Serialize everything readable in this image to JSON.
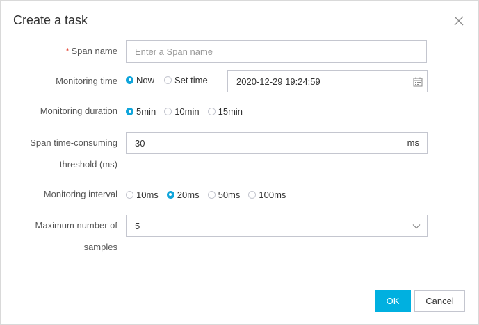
{
  "dialog": {
    "title": "Create a task",
    "close_icon": "close-icon"
  },
  "span_name": {
    "required_mark": "*",
    "label": "Span name",
    "placeholder": "Enter a Span name",
    "value": ""
  },
  "monitoring_time": {
    "label": "Monitoring time",
    "options": [
      {
        "label": "Now",
        "selected": true
      },
      {
        "label": "Set time",
        "selected": false
      }
    ],
    "datetime_value": "2020-12-29 19:24:59",
    "icon": "calendar-icon"
  },
  "monitoring_duration": {
    "label": "Monitoring duration",
    "options": [
      {
        "label": "5min",
        "selected": true
      },
      {
        "label": "10min",
        "selected": false
      },
      {
        "label": "15min",
        "selected": false
      }
    ]
  },
  "threshold": {
    "label_line1": "Span time-consuming",
    "label_line2": "threshold (ms)",
    "value": "30",
    "suffix": "ms"
  },
  "monitoring_interval": {
    "label": "Monitoring interval",
    "options": [
      {
        "label": "10ms",
        "selected": false
      },
      {
        "label": "20ms",
        "selected": true
      },
      {
        "label": "50ms",
        "selected": false
      },
      {
        "label": "100ms",
        "selected": false
      }
    ]
  },
  "max_samples": {
    "label_line1": "Maximum number of",
    "label_line2": "samples",
    "value": "5",
    "icon": "chevron-down-icon"
  },
  "footer": {
    "ok_label": "OK",
    "cancel_label": "Cancel"
  },
  "colors": {
    "accent": "#00b0e0",
    "radio_selected": "#10a5db",
    "required": "#e0301e",
    "border": "#c4c6cf"
  }
}
